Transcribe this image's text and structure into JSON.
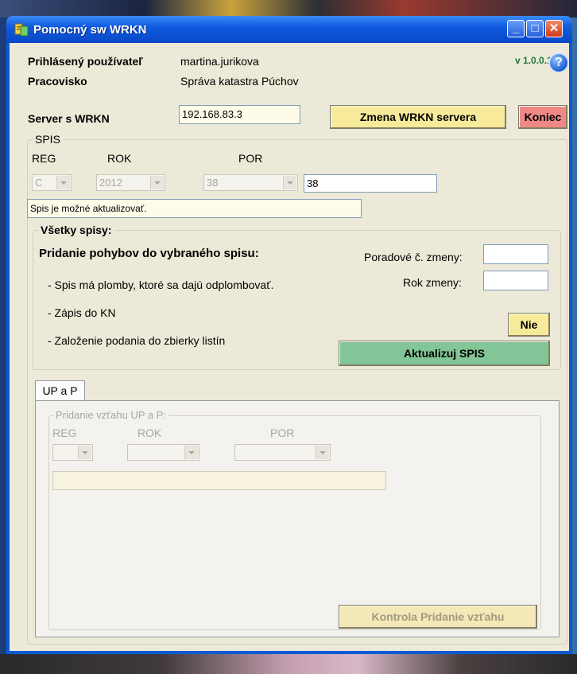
{
  "window": {
    "title": "Pomocný sw WRKN",
    "minimize": "_",
    "maximize": "□",
    "close": "✕"
  },
  "user": {
    "label": "Prihlásený používateľ",
    "value": "martina.jurikova",
    "workplace_label": "Pracovisko",
    "workplace_value": "Správa katastra Púchov",
    "version": "v 1.0.0.13",
    "help": "?"
  },
  "server": {
    "label": "Server s WRKN",
    "value": "192.168.83.3",
    "change_button": "Zmena WRKN servera",
    "exit_button": "Koniec"
  },
  "spis": {
    "group_title": "SPIS",
    "reg_label": "REG",
    "rok_label": "ROK",
    "por_label": "POR",
    "reg_value": "C",
    "rok_value": "2012",
    "por_value": "38",
    "por_input": "38",
    "status": "Spis je možné aktualizovať."
  },
  "all": {
    "group_title": "Všetky spisy:",
    "heading": "Pridanie pohybov do vybraného spisu:",
    "items": [
      "-  Spis má plomby, ktoré sa dajú odplombovať.",
      "-  Zápis do KN",
      "-  Založenie podania do zbierky listín"
    ],
    "order_label": "Poradové č. zmeny:",
    "year_label": "Rok zmeny:",
    "order_value": "",
    "year_value": "",
    "no_button": "Nie",
    "update_button": "Aktualizuj SPIS"
  },
  "tabs": {
    "up_label": "UP a P"
  },
  "up": {
    "group_title": "Pridanie vzťahu UP a P:",
    "reg_label": "REG",
    "rok_label": "ROK",
    "por_label": "POR",
    "note_value": "",
    "check_button": "Kontrola Pridanie vzťahu"
  }
}
